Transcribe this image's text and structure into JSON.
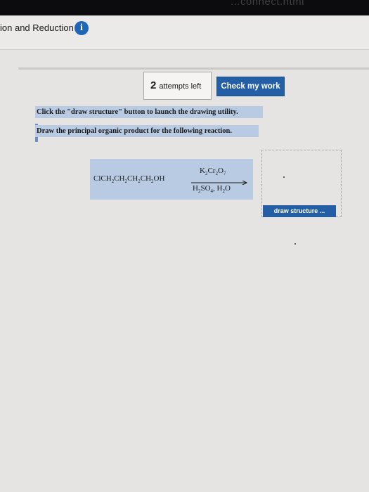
{
  "browser": {
    "url_fragment": "...connect.html"
  },
  "header": {
    "title": "ion and Reduction",
    "info_icon": "info-icon"
  },
  "toolbar": {
    "attempts_count": "2",
    "attempts_label": "attempts left",
    "check_label": "Check my work"
  },
  "instructions": [
    "Click the \"draw structure\" button to launch the drawing utility.",
    "Draw the principal organic product for the following reaction."
  ],
  "reaction": {
    "reactant": "ClCH2CH2CH2CH2OH",
    "reagent_top": "K2Cr2O7",
    "reagent_bottom": "H2SO4, H2O"
  },
  "draw_button": {
    "label": "draw structure ..."
  },
  "colors": {
    "accent": "#245fa6",
    "highlight": "#b9cbe3",
    "info": "#1f66b8"
  }
}
